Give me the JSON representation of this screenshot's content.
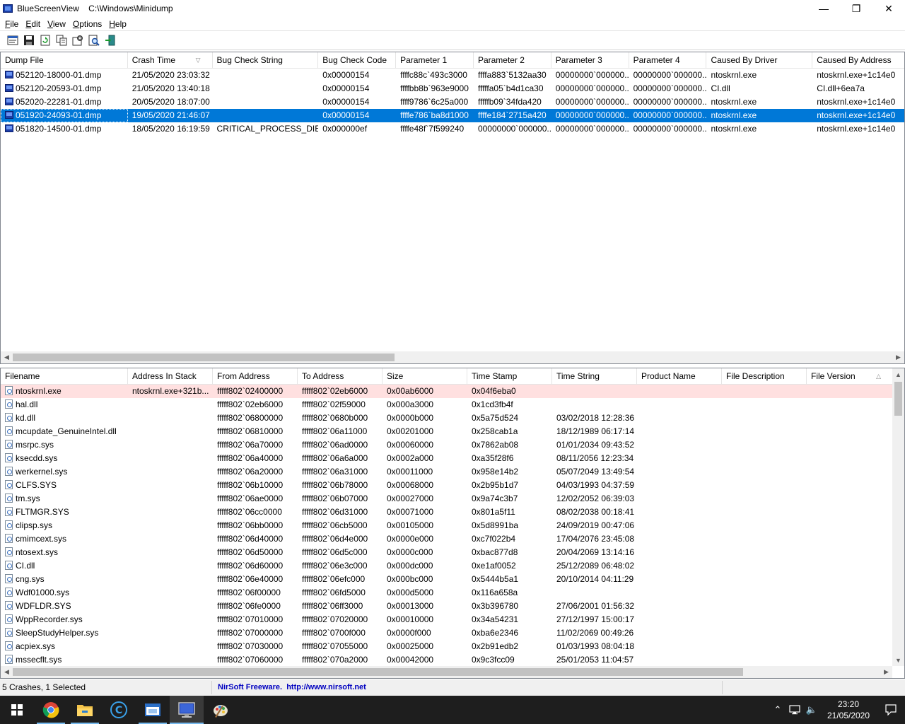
{
  "window": {
    "app_name": "BlueScreenView",
    "title": "BlueScreenView    C:\\Windows\\Minidump",
    "minimize": "—",
    "maximize": "❐",
    "close": "✕"
  },
  "menu": [
    {
      "label": "File",
      "accel": "F",
      "rest": "ile"
    },
    {
      "label": "Edit",
      "accel": "E",
      "rest": "dit"
    },
    {
      "label": "View",
      "accel": "V",
      "rest": "iew"
    },
    {
      "label": "Options",
      "accel": "O",
      "rest": "ptions"
    },
    {
      "label": "Help",
      "accel": "H",
      "rest": "elp"
    }
  ],
  "toolbar": {
    "buttons": [
      "properties-icon",
      "save-icon",
      "refresh-icon",
      "copy-icon",
      "options-icon",
      "find-icon",
      "exit-icon"
    ]
  },
  "crashes": {
    "columns": [
      "Dump File",
      "Crash Time",
      "Bug Check String",
      "Bug Check Code",
      "Parameter 1",
      "Parameter 2",
      "Parameter 3",
      "Parameter 4",
      "Caused By Driver",
      "Caused By Address"
    ],
    "sort_column_mark": "▽",
    "rows": [
      [
        "052120-18000-01.dmp",
        "21/05/2020 23:03:32",
        "",
        "0x00000154",
        "ffffc88c`493c3000",
        "ffffa883`5132aa30",
        "00000000`000000...",
        "00000000`000000...",
        "ntoskrnl.exe",
        "ntoskrnl.exe+1c14e0"
      ],
      [
        "052120-20593-01.dmp",
        "21/05/2020 13:40:18",
        "",
        "0x00000154",
        "ffffbb8b`963e9000",
        "fffffa05`b4d1ca30",
        "00000000`000000...",
        "00000000`000000...",
        "CI.dll",
        "CI.dll+6ea7a"
      ],
      [
        "052020-22281-01.dmp",
        "20/05/2020 18:07:00",
        "",
        "0x00000154",
        "ffff9786`6c25a000",
        "fffffb09`34fda420",
        "00000000`000000...",
        "00000000`000000...",
        "ntoskrnl.exe",
        "ntoskrnl.exe+1c14e0"
      ],
      [
        "051920-24093-01.dmp",
        "19/05/2020 21:46:07",
        "",
        "0x00000154",
        "ffffe786`ba8d1000",
        "ffffe184`2715a420",
        "00000000`000000...",
        "00000000`000000...",
        "ntoskrnl.exe",
        "ntoskrnl.exe+1c14e0"
      ],
      [
        "051820-14500-01.dmp",
        "18/05/2020 16:19:59",
        "CRITICAL_PROCESS_DIED",
        "0x000000ef",
        "ffffe48f`7f599240",
        "00000000`000000...",
        "00000000`000000...",
        "00000000`000000...",
        "ntoskrnl.exe",
        "ntoskrnl.exe+1c14e0"
      ]
    ],
    "selected_index": 3
  },
  "modules": {
    "columns": [
      "Filename",
      "Address In Stack",
      "From Address",
      "To Address",
      "Size",
      "Time Stamp",
      "Time String",
      "Product Name",
      "File Description",
      "File Version"
    ],
    "sort_column_mark": "△",
    "rows": [
      [
        "ntoskrnl.exe",
        "ntoskrnl.exe+321b...",
        "fffff802`02400000",
        "fffff802`02eb6000",
        "0x00ab6000",
        "0x04f6eba0",
        ""
      ],
      [
        "hal.dll",
        "",
        "fffff802`02eb6000",
        "fffff802`02f59000",
        "0x000a3000",
        "0x1cd3fb4f",
        ""
      ],
      [
        "kd.dll",
        "",
        "fffff802`06800000",
        "fffff802`0680b000",
        "0x0000b000",
        "0x5a75d524",
        "03/02/2018 12:28:36"
      ],
      [
        "mcupdate_GenuineIntel.dll",
        "",
        "fffff802`06810000",
        "fffff802`06a11000",
        "0x00201000",
        "0x258cab1a",
        "18/12/1989 06:17:14"
      ],
      [
        "msrpc.sys",
        "",
        "fffff802`06a70000",
        "fffff802`06ad0000",
        "0x00060000",
        "0x7862ab08",
        "01/01/2034 09:43:52"
      ],
      [
        "ksecdd.sys",
        "",
        "fffff802`06a40000",
        "fffff802`06a6a000",
        "0x0002a000",
        "0xa35f28f6",
        "08/11/2056 12:23:34"
      ],
      [
        "werkernel.sys",
        "",
        "fffff802`06a20000",
        "fffff802`06a31000",
        "0x00011000",
        "0x958e14b2",
        "05/07/2049 13:49:54"
      ],
      [
        "CLFS.SYS",
        "",
        "fffff802`06b10000",
        "fffff802`06b78000",
        "0x00068000",
        "0x2b95b1d7",
        "04/03/1993 04:37:59"
      ],
      [
        "tm.sys",
        "",
        "fffff802`06ae0000",
        "fffff802`06b07000",
        "0x00027000",
        "0x9a74c3b7",
        "12/02/2052 06:39:03"
      ],
      [
        "FLTMGR.SYS",
        "",
        "fffff802`06cc0000",
        "fffff802`06d31000",
        "0x00071000",
        "0x801a5f11",
        "08/02/2038 00:18:41"
      ],
      [
        "clipsp.sys",
        "",
        "fffff802`06bb0000",
        "fffff802`06cb5000",
        "0x00105000",
        "0x5d8991ba",
        "24/09/2019 00:47:06"
      ],
      [
        "cmimcext.sys",
        "",
        "fffff802`06d40000",
        "fffff802`06d4e000",
        "0x0000e000",
        "0xc7f022b4",
        "17/04/2076 23:45:08"
      ],
      [
        "ntosext.sys",
        "",
        "fffff802`06d50000",
        "fffff802`06d5c000",
        "0x0000c000",
        "0xbac877d8",
        "20/04/2069 13:14:16"
      ],
      [
        "CI.dll",
        "",
        "fffff802`06d60000",
        "fffff802`06e3c000",
        "0x000dc000",
        "0xe1af0052",
        "25/12/2089 06:48:02"
      ],
      [
        "cng.sys",
        "",
        "fffff802`06e40000",
        "fffff802`06efc000",
        "0x000bc000",
        "0x5444b5a1",
        "20/10/2014 04:11:29"
      ],
      [
        "Wdf01000.sys",
        "",
        "fffff802`06f00000",
        "fffff802`06fd5000",
        "0x000d5000",
        "0x116a658a",
        ""
      ],
      [
        "WDFLDR.SYS",
        "",
        "fffff802`06fe0000",
        "fffff802`06ff3000",
        "0x00013000",
        "0x3b396780",
        "27/06/2001 01:56:32"
      ],
      [
        "WppRecorder.sys",
        "",
        "fffff802`07010000",
        "fffff802`07020000",
        "0x00010000",
        "0x34a54231",
        "27/12/1997 15:00:17"
      ],
      [
        "SleepStudyHelper.sys",
        "",
        "fffff802`07000000",
        "fffff802`0700f000",
        "0x0000f000",
        "0xba6e2346",
        "11/02/2069 00:49:26"
      ],
      [
        "acpiex.sys",
        "",
        "fffff802`07030000",
        "fffff802`07055000",
        "0x00025000",
        "0x2b91edb2",
        "01/03/1993 08:04:18"
      ],
      [
        "mssecflt.sys",
        "",
        "fffff802`07060000",
        "fffff802`070a2000",
        "0x00042000",
        "0x9c3fcc09",
        "25/01/2053 11:04:57"
      ]
    ],
    "highlight_index": 0
  },
  "status": {
    "count_text": "5 Crashes, 1 Selected",
    "credit_text": "NirSoft Freeware.  http://www.nirsoft.net"
  },
  "taskbar": {
    "apps": [
      "windows-start-icon",
      "chrome-icon",
      "file-explorer-icon",
      "ccleaner-icon",
      "app-window-icon",
      "bluescreenview-icon",
      "paint-icon"
    ],
    "clock_time": "23:20",
    "clock_date": "21/05/2020",
    "tray_chevron": "⌃",
    "volume_glyph": "🔈"
  },
  "colors": {
    "selection": "#0078d7",
    "highlight_row": "#ffe0e0",
    "credit_link": "#0000c0",
    "taskbar": "#1e1e1e"
  }
}
